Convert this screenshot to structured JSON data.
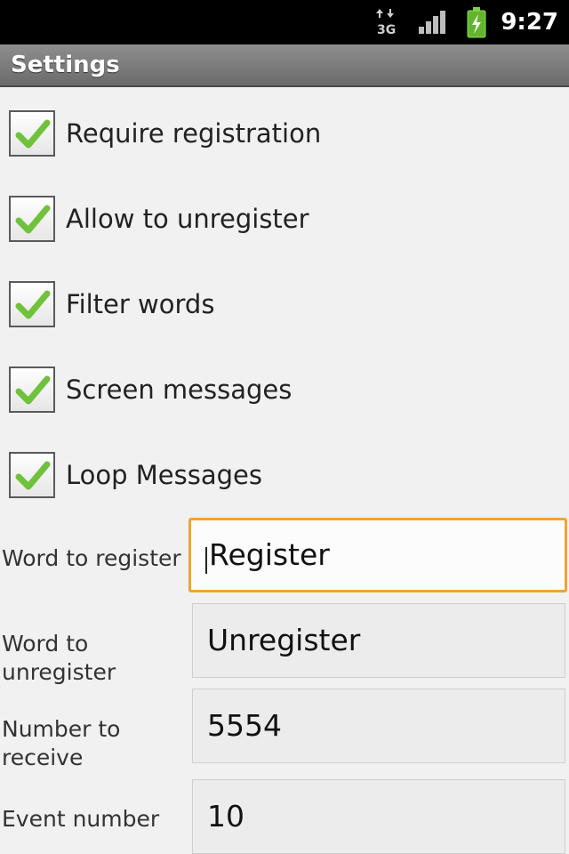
{
  "status_bar": {
    "time": "9:27",
    "network_type_icon": "3g-data-icon",
    "signal_icon": "signal-strength-icon",
    "battery_icon": "battery-charging-icon"
  },
  "title_bar": {
    "title": "Settings"
  },
  "checkboxes": [
    {
      "label": "Require registration",
      "checked": true
    },
    {
      "label": "Allow to unregister",
      "checked": true
    },
    {
      "label": "Filter words",
      "checked": true
    },
    {
      "label": "Screen messages",
      "checked": true
    },
    {
      "label": "Loop Messages",
      "checked": true
    }
  ],
  "fields": [
    {
      "label": "Word to register",
      "value": "Register",
      "focused": true
    },
    {
      "label": "Word to unregister",
      "label_line1": "Word to",
      "label_line2": "unregister",
      "value": "Unregister",
      "focused": false
    },
    {
      "label": "Number to receive",
      "label_line1": "Number to",
      "label_line2": "receive",
      "value": "5554",
      "focused": false
    },
    {
      "label": "Event number",
      "value": "10",
      "focused": false
    }
  ],
  "colors": {
    "check_green": "#6fc23b",
    "focus_orange": "#f0a52a",
    "title_bar": "#7d7d7d",
    "background": "#f1f1f1"
  }
}
